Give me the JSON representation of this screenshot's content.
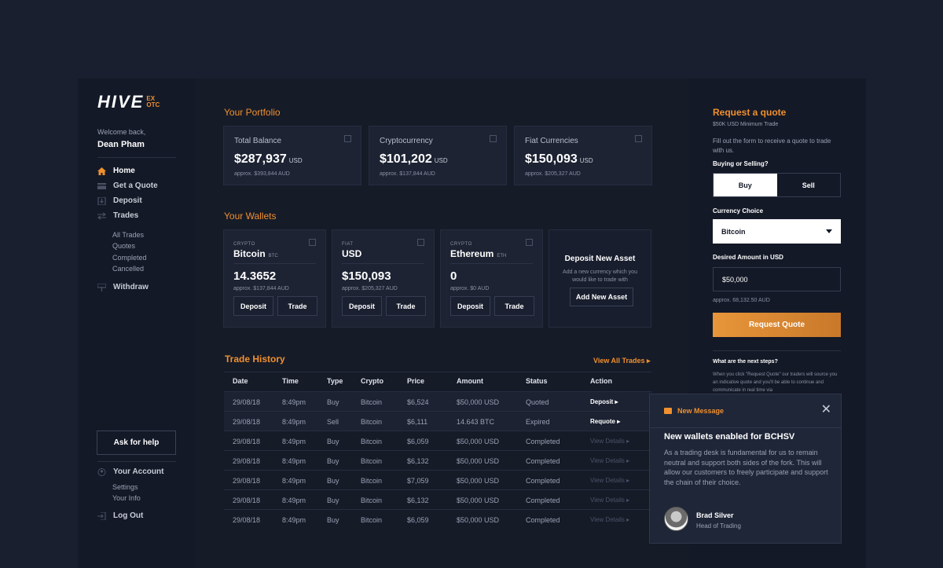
{
  "brand": {
    "name": "HIVE",
    "badge_top": "EX",
    "badge_bottom": "OTC"
  },
  "sidebar": {
    "welcome": "Welcome back,",
    "user_name": "Dean Pham",
    "nav": [
      {
        "label": "Home",
        "icon": "home-icon"
      },
      {
        "label": "Get a Quote",
        "icon": "quote-icon"
      },
      {
        "label": "Deposit",
        "icon": "deposit-icon"
      },
      {
        "label": "Trades",
        "icon": "trades-icon"
      }
    ],
    "trade_sub": [
      "All Trades",
      "Quotes",
      "Completed",
      "Cancelled"
    ],
    "withdraw": "Withdraw",
    "help": "Ask for help",
    "account": "Your Account",
    "account_sub": [
      "Settings",
      "Your Info"
    ],
    "logout": "Log Out"
  },
  "portfolio": {
    "title": "Your Portfolio",
    "cards": [
      {
        "label": "Total Balance",
        "value": "$287,937",
        "unit": "USD",
        "approx": "approx. $393,844 AUD"
      },
      {
        "label": "Cryptocurrency",
        "value": "$101,202",
        "unit": "USD",
        "approx": "approx. $137,844 AUD"
      },
      {
        "label": "Fiat Currencies",
        "value": "$150,093",
        "unit": "USD",
        "approx": "approx. $205,327 AUD"
      }
    ]
  },
  "wallets": {
    "title": "Your Wallets",
    "items": [
      {
        "tag": "CRYPTO",
        "name": "Bitcoin",
        "code": "BTC",
        "amount": "14.3652",
        "approx": "approx. $137,844 AUD"
      },
      {
        "tag": "FIAT",
        "name": "USD",
        "code": "",
        "amount": "$150,093",
        "approx": "approx. $205,327 AUD"
      },
      {
        "tag": "CRYPTO",
        "name": "Ethereum",
        "code": "ETH",
        "amount": "0",
        "approx": "approx. $0 AUD"
      }
    ],
    "deposit_label": "Deposit",
    "trade_label": "Trade",
    "new_asset": {
      "title": "Deposit New Asset",
      "desc": "Add a new currency which you would like to trade with",
      "button": "Add New Asset"
    }
  },
  "history": {
    "title": "Trade History",
    "view_all": "View All Trades",
    "columns": [
      "Date",
      "Time",
      "Type",
      "Crypto",
      "Price",
      "Amount",
      "Status",
      "Action"
    ],
    "rows": [
      {
        "date": "29/08/18",
        "time": "8:49pm",
        "type": "Buy",
        "crypto": "Bitcoin",
        "price": "$6,524",
        "amount": "$50,000 USD",
        "status": "Quoted",
        "action": "Deposit"
      },
      {
        "date": "29/08/18",
        "time": "8:49pm",
        "type": "Sell",
        "crypto": "Bitcoin",
        "price": "$6,111",
        "amount": "14.643 BTC",
        "status": "Expired",
        "action": "Requote"
      },
      {
        "date": "29/08/18",
        "time": "8:49pm",
        "type": "Buy",
        "crypto": "Bitcoin",
        "price": "$6,059",
        "amount": "$50,000 USD",
        "status": "Completed",
        "action": "View Details"
      },
      {
        "date": "29/08/18",
        "time": "8:49pm",
        "type": "Buy",
        "crypto": "Bitcoin",
        "price": "$6,132",
        "amount": "$50,000 USD",
        "status": "Completed",
        "action": "View Details"
      },
      {
        "date": "29/08/18",
        "time": "8:49pm",
        "type": "Buy",
        "crypto": "Bitcoin",
        "price": "$7,059",
        "amount": "$50,000 USD",
        "status": "Completed",
        "action": "View Details"
      },
      {
        "date": "29/08/18",
        "time": "8:49pm",
        "type": "Buy",
        "crypto": "Bitcoin",
        "price": "$6,132",
        "amount": "$50,000 USD",
        "status": "Completed",
        "action": "View Details"
      },
      {
        "date": "29/08/18",
        "time": "8:49pm",
        "type": "Buy",
        "crypto": "Bitcoin",
        "price": "$6,059",
        "amount": "$50,000 USD",
        "status": "Completed",
        "action": "View Details"
      }
    ]
  },
  "quote": {
    "title": "Request a quote",
    "minimum": "$50K USD Minimum Trade",
    "desc": "Fill out the form to receive a quote to trade with us.",
    "buy_sell_label": "Buying or Selling?",
    "buy": "Buy",
    "sell": "Sell",
    "currency_label": "Currency Choice",
    "currency_value": "Bitcoin",
    "amount_label": "Desired Amount in USD",
    "amount_value": "$50,000",
    "amount_approx": "approx. 68,132.50 AUD",
    "submit": "Request Quote",
    "next_title": "What are the next steps?",
    "next_desc": "When you click \"Request Quote\" our traders will source you an indicative quote and you'll be able to continue and communicate in real time via"
  },
  "message": {
    "header": "New Message",
    "title": "New wallets enabled for BCHSV",
    "body": "As a trading desk is fundamental for us to remain neutral and support both sides of the fork. This will allow our customers to freely participate and support the chain of their choice.",
    "sender": "Brad Silver",
    "role": "Head of Trading"
  },
  "colors": {
    "accent": "#f0902e",
    "background": "#1a1f30",
    "panel": "#141927",
    "card": "#1d2333"
  }
}
